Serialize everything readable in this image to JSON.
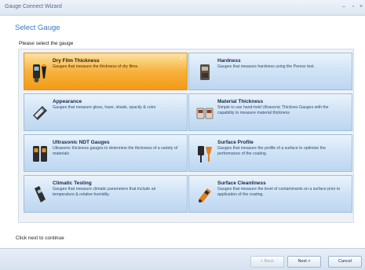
{
  "window": {
    "title": "Gauge Connect Wizard",
    "minimize_glyph": "–",
    "maximize_glyph": "▫",
    "close_glyph": "×"
  },
  "page": {
    "heading": "Select Gauge",
    "prompt": "Please select the gauge",
    "footer": "Click next to continue"
  },
  "gauges": [
    {
      "title": "Dry Film Thickness",
      "desc": "Gauges that measure the thickness of dry films.",
      "selected": true,
      "check": "✓",
      "icon": "dft-gauge-icon"
    },
    {
      "title": "Hardness",
      "desc": "Gauges that measure hardness using the Persoz test.",
      "selected": false,
      "icon": "hardness-gauge-icon"
    },
    {
      "title": "Appearance",
      "desc": "Gauges that measure gloss, haze, shade, opacity & color",
      "selected": false,
      "icon": "glossmeter-icon"
    },
    {
      "title": "Material Thickness",
      "desc": "Simple to use hand-held Ultrasonic Thicknes Gauges with the capability to measure material thickness",
      "selected": false,
      "icon": "material-thickness-icon"
    },
    {
      "title": "Ultrasonic NDT Gauges",
      "desc": "Ultrasonic thickness gauges to determine the thickness of a variety of materials",
      "selected": false,
      "icon": "ultrasonic-gauge-icon"
    },
    {
      "title": "Surface Profile",
      "desc": "Gauges that measure the profile of a surface to optimize the performance of the coating.",
      "selected": false,
      "icon": "surface-profile-icon"
    },
    {
      "title": "Climatic Testing",
      "desc": "Gauges that measure climatic parameters that include air temperature & relative humidity.",
      "selected": false,
      "icon": "climatic-gauge-icon"
    },
    {
      "title": "Surface Cleanliness",
      "desc": "Gauges that measure the level of contaminants on a surface prior to application of the coating.",
      "selected": false,
      "icon": "surface-cleanliness-icon"
    }
  ],
  "buttons": {
    "back": "< Back",
    "next": "Next >",
    "cancel": "Cancel"
  },
  "colors": {
    "heading": "#3b79c2",
    "selected_card": "#f29a15",
    "card": "#bcd6f0"
  }
}
